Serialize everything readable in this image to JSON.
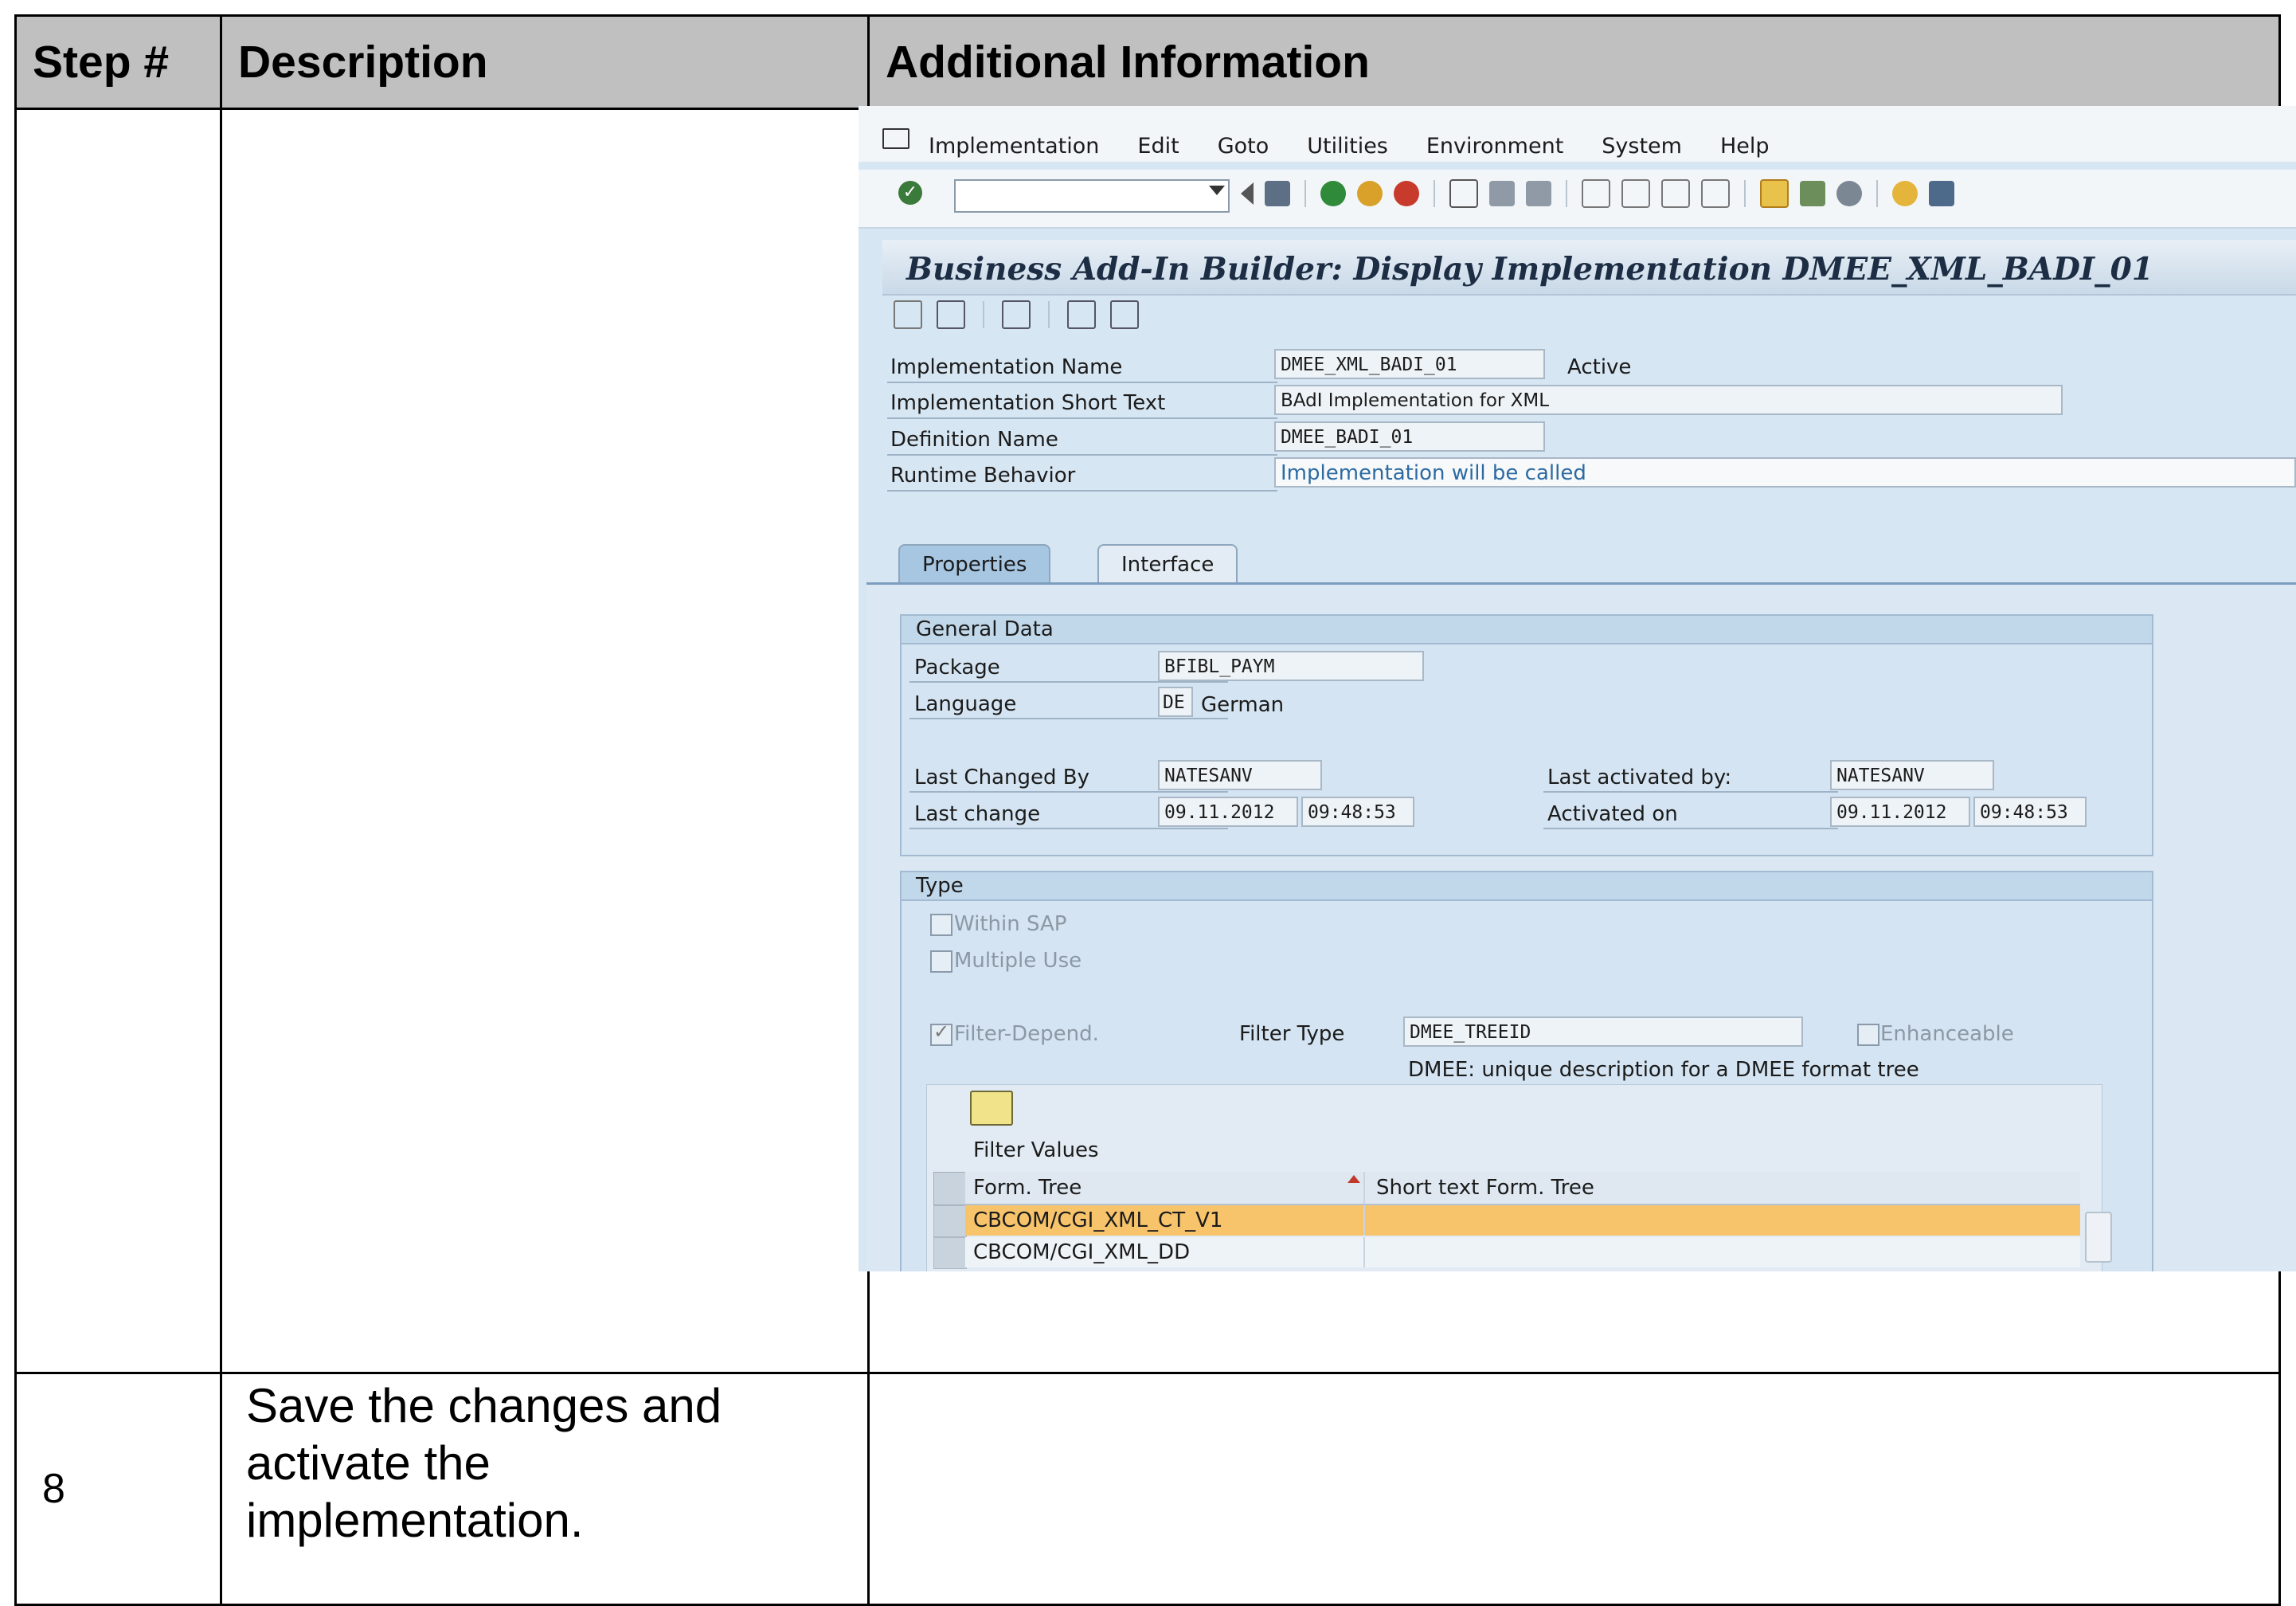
{
  "table": {
    "headers": [
      "Step #",
      "Description",
      "Additional Information"
    ],
    "rows": [
      {
        "step": "",
        "description": ""
      },
      {
        "step": "8",
        "description": "Save the changes and activate the implementation."
      }
    ]
  },
  "sap": {
    "menu": [
      "Implementation",
      "Edit",
      "Goto",
      "Utilities",
      "Environment",
      "System",
      "Help"
    ],
    "title": "Business Add-In Builder: Display Implementation DMEE_XML_BADI_01",
    "header_fields": {
      "impl_name_label": "Implementation Name",
      "impl_name_value": "DMEE_XML_BADI_01",
      "impl_status": "Active",
      "short_text_label": "Implementation Short Text",
      "short_text_value": "BAdI Implementation for XML",
      "def_name_label": "Definition Name",
      "def_name_value": "DMEE_BADI_01",
      "runtime_label": "Runtime Behavior",
      "runtime_value": "Implementation will be called"
    },
    "tabs": [
      "Properties",
      "Interface"
    ],
    "general": {
      "title": "General Data",
      "package_label": "Package",
      "package_value": "BFIBL_PAYM",
      "language_label": "Language",
      "language_code": "DE",
      "language_name": "German",
      "last_changed_by_label": "Last Changed By",
      "last_changed_by_value": "NATESANV",
      "last_change_label": "Last change",
      "last_change_date": "09.11.2012",
      "last_change_time": "09:48:53",
      "last_activated_by_label": "Last activated by:",
      "last_activated_by_value": "NATESANV",
      "activated_on_label": "Activated on",
      "activated_on_date": "09.11.2012",
      "activated_on_time": "09:48:53"
    },
    "type": {
      "title": "Type",
      "within_sap": "Within SAP",
      "multiple_use": "Multiple Use",
      "filter_depend": "Filter-Depend.",
      "filter_type_label": "Filter Type",
      "filter_type_value": "DMEE_TREEID",
      "enhanceable": "Enhanceable",
      "filter_desc": "DMEE: unique description for a DMEE format tree",
      "filter_values_label": "Filter Values",
      "col_form_tree": "Form. Tree",
      "col_short_text": "Short text Form. Tree",
      "rows": [
        "CBCOM/CGI_XML_CT_V1",
        "CBCOM/CGI_XML_DD"
      ]
    }
  }
}
